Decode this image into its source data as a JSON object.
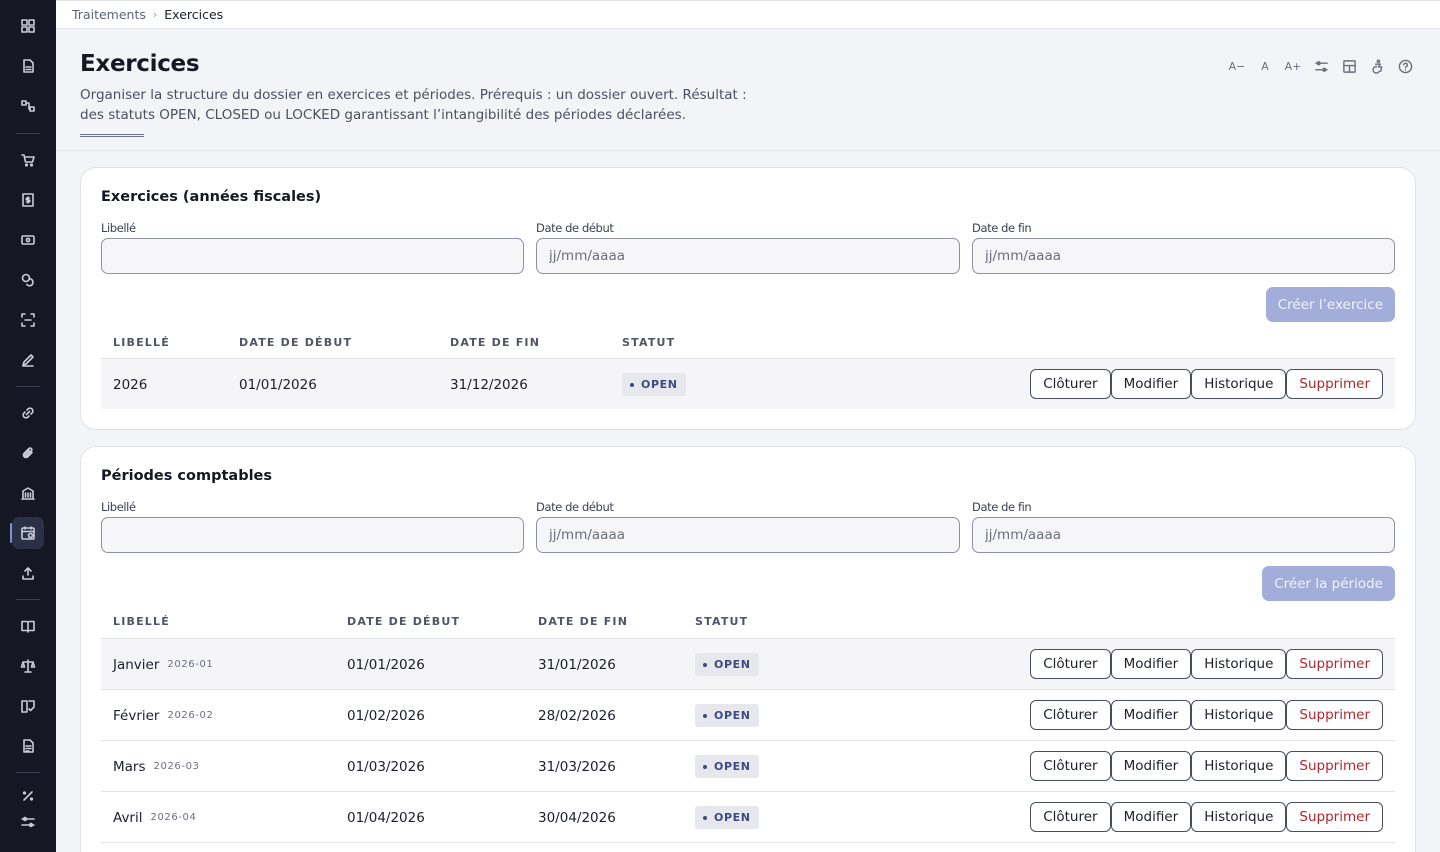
{
  "breadcrumb": {
    "parent": "Traitements",
    "separator": "›",
    "current": "Exercices"
  },
  "header": {
    "title": "Exercices",
    "description": "Organiser la structure du dossier en exercices et périodes. Prérequis : un dossier ouvert. Résultat : des statuts OPEN, CLOSED ou LOCKED garantissant l’intangibilité des périodes déclarées.",
    "toolbar": {
      "font_smaller": "A−",
      "font_normal": "A",
      "font_larger": "A+"
    }
  },
  "sidebar": {
    "icons": [
      "dashboard-icon",
      "document-icon",
      "flow-icon",
      "cart-icon",
      "invoice-icon",
      "banknote-icon",
      "coins-icon",
      "scan-icon",
      "edit-icon",
      "link-icon",
      "attachment-icon",
      "building-icon",
      "calendar-icon",
      "upload-icon",
      "book-icon",
      "scale-icon",
      "ledger-icon",
      "report-icon",
      "percent-icon",
      "settings-sliders-icon"
    ],
    "active": "calendar-icon"
  },
  "exercices": {
    "title": "Exercices (années fiscales)",
    "form": {
      "label_libelle": "Libellé",
      "label_debut": "Date de début",
      "label_fin": "Date de fin",
      "placeholder_libelle": "",
      "placeholder_debut": "jj/mm/aaaa",
      "placeholder_fin": "jj/mm/aaaa",
      "submit": "Créer l’exercice"
    },
    "columns": [
      "LIBELLÉ",
      "DATE DE DÉBUT",
      "DATE DE FIN",
      "STATUT"
    ],
    "rows": [
      {
        "libelle": "2026",
        "debut": "01/01/2026",
        "fin": "31/12/2026",
        "statut": "OPEN"
      }
    ]
  },
  "periodes": {
    "title": "Périodes comptables",
    "form": {
      "label_libelle": "Libellé",
      "label_debut": "Date de début",
      "label_fin": "Date de fin",
      "placeholder_libelle": "",
      "placeholder_debut": "jj/mm/aaaa",
      "placeholder_fin": "jj/mm/aaaa",
      "submit": "Créer la période"
    },
    "columns": [
      "LIBELLÉ",
      "DATE DE DÉBUT",
      "DATE DE FIN",
      "STATUT"
    ],
    "rows": [
      {
        "libelle": "Janvier",
        "code": "2026-01",
        "debut": "01/01/2026",
        "fin": "31/01/2026",
        "statut": "OPEN"
      },
      {
        "libelle": "Février",
        "code": "2026-02",
        "debut": "01/02/2026",
        "fin": "28/02/2026",
        "statut": "OPEN"
      },
      {
        "libelle": "Mars",
        "code": "2026-03",
        "debut": "01/03/2026",
        "fin": "31/03/2026",
        "statut": "OPEN"
      },
      {
        "libelle": "Avril",
        "code": "2026-04",
        "debut": "01/04/2026",
        "fin": "30/04/2026",
        "statut": "OPEN"
      }
    ]
  },
  "row_actions": {
    "close": "Clôturer",
    "edit": "Modifier",
    "history": "Historique",
    "delete": "Supprimer"
  },
  "colors": {
    "sidebar_bg": "#151824",
    "primary_disabled": "#a2aed9",
    "danger": "#b3262d",
    "badge_text": "#3d4a82"
  }
}
